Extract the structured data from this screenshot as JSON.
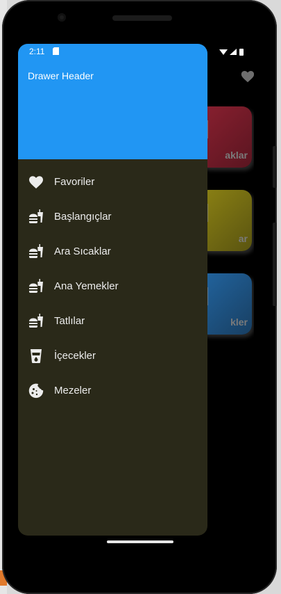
{
  "status_bar": {
    "time": "2:11"
  },
  "drawer": {
    "header_title": "Drawer Header",
    "items": [
      {
        "label": "Favoriler",
        "icon": "heart-icon"
      },
      {
        "label": "Başlangıçlar",
        "icon": "fastfood-icon"
      },
      {
        "label": "Ara Sıcaklar",
        "icon": "fastfood-icon"
      },
      {
        "label": "Ana Yemekler",
        "icon": "fastfood-icon"
      },
      {
        "label": "Tatlılar",
        "icon": "fastfood-icon"
      },
      {
        "label": "İçecekler",
        "icon": "drink-icon"
      },
      {
        "label": "Mezeler",
        "icon": "cookie-icon"
      }
    ]
  },
  "background": {
    "cards": [
      {
        "label": "aklar",
        "color": "#7b1f2c"
      },
      {
        "label": "ar",
        "color": "#7c7410"
      },
      {
        "label": "kler",
        "color": "#1f5684"
      }
    ]
  },
  "colors": {
    "header": "#2196f3",
    "drawer": "#2a2919"
  }
}
